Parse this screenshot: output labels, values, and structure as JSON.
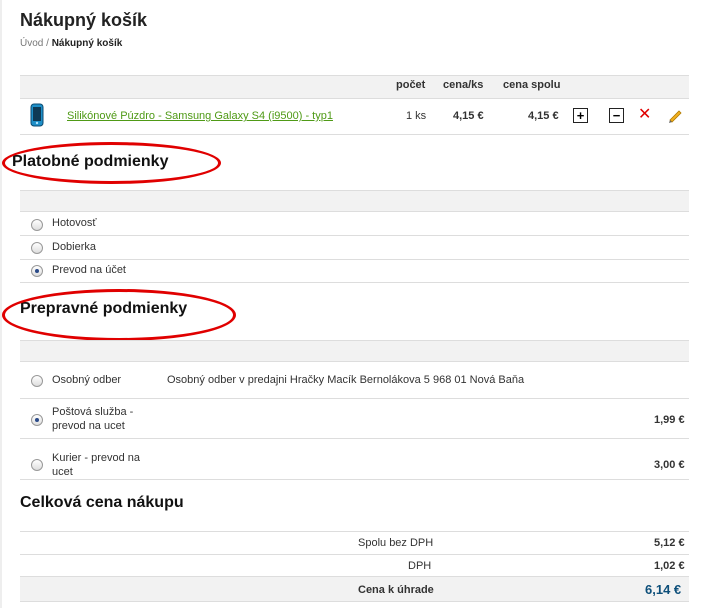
{
  "page": {
    "title": "Nákupný košík",
    "breadcrumb_home": "Úvod",
    "breadcrumb_sep": "/",
    "breadcrumb_current": "Nákupný košík"
  },
  "cart": {
    "headers": {
      "count": "počet",
      "unit_price": "cena/ks",
      "total": "cena spolu"
    },
    "item": {
      "name": "Silikónové Púzdro - Samsung Galaxy S4 (i9500) - typ1",
      "qty": "1 ks",
      "unit_price": "4,15 €",
      "total": "4,15 €",
      "plus": "+",
      "minus": "−",
      "remove": "✕"
    }
  },
  "payment": {
    "title": "Platobné podmienky",
    "options": [
      {
        "label": "Hotovosť",
        "selected": false
      },
      {
        "label": "Dobierka",
        "selected": false
      },
      {
        "label": "Prevod na účet",
        "selected": true
      }
    ]
  },
  "shipping": {
    "title": "Prepravné podmienky",
    "options": [
      {
        "label": "Osobný odber",
        "note": "Osobný odber v predajni Hračky Macík Bernolákova 5 968 01 Nová Baňa",
        "price": "",
        "selected": false
      },
      {
        "label_line1": "Poštová služba -",
        "label_line2": "prevod na ucet",
        "price": "1,99 €",
        "selected": true
      },
      {
        "label_line1": "Kurier - prevod na",
        "label_line2": "ucet",
        "price": "3,00 €",
        "selected": false
      }
    ]
  },
  "summary": {
    "title": "Celková cena nákupu",
    "rows": [
      {
        "label": "Spolu bez DPH",
        "value": "5,12 €"
      },
      {
        "label": "DPH",
        "value": "1,02 €"
      },
      {
        "label": "Cena k úhrade",
        "value": "6,14 €"
      }
    ]
  },
  "colors": {
    "annotation": "#e00000",
    "link": "#4f9a16",
    "total": "#0d4f7a"
  }
}
